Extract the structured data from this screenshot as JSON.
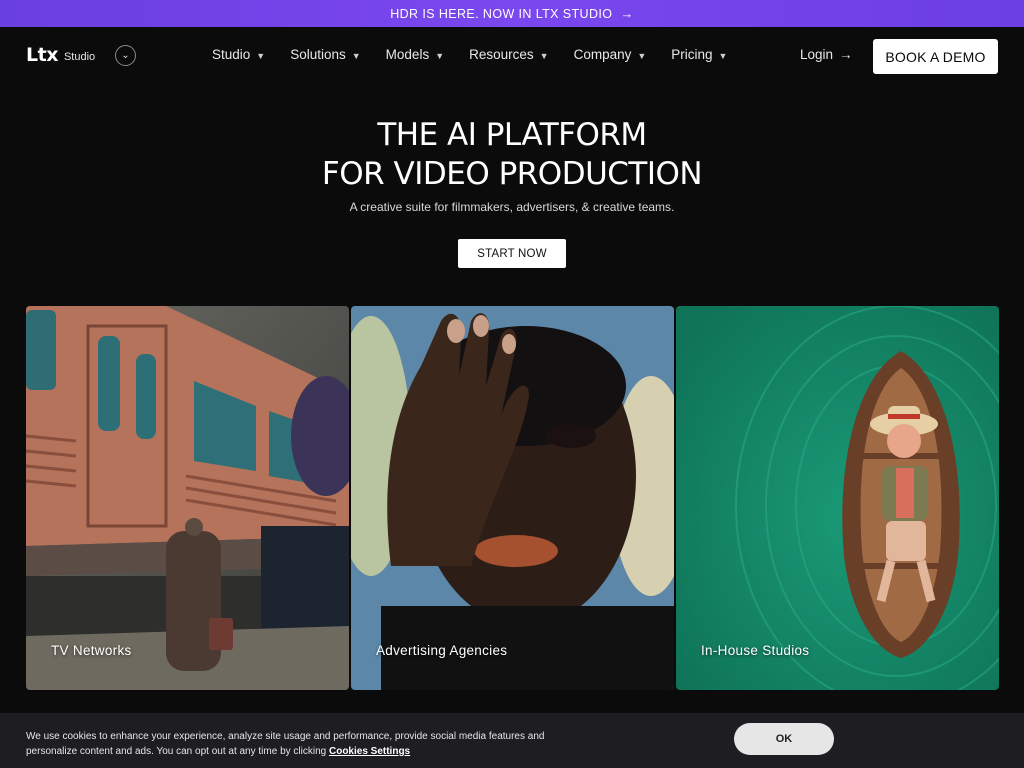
{
  "banner": {
    "text": "HDR IS HERE. NOW IN LTX STUDIO",
    "arrow": "→"
  },
  "logo": {
    "mark": "Ltx",
    "sub": "Studio",
    "toggle_icon": "chevron-down-icon"
  },
  "nav": {
    "items": [
      {
        "label": "Studio"
      },
      {
        "label": "Solutions"
      },
      {
        "label": "Models"
      },
      {
        "label": "Resources"
      },
      {
        "label": "Company"
      },
      {
        "label": "Pricing"
      }
    ],
    "login": "Login",
    "login_arrow": "→",
    "demo": "BOOK A DEMO"
  },
  "hero": {
    "title_line1": "THE AI PLATFORM",
    "title_line2": "FOR VIDEO PRODUCTION",
    "subtitle": "A creative suite for filmmakers, advertisers, & creative teams.",
    "cta": "START NOW"
  },
  "cards": [
    {
      "label": "TV Networks"
    },
    {
      "label": "Advertising Agencies"
    },
    {
      "label": "In-House Studios"
    }
  ],
  "cookie": {
    "text": "We use cookies to enhance your experience, analyze site usage and performance, provide social media features and personalize content and ads. You can opt out at any time by clicking ",
    "link": "Cookies Settings",
    "ok": "OK"
  },
  "colors": {
    "banner": "#7444ea",
    "background": "#0b0b0c",
    "card3": "#17906e"
  }
}
